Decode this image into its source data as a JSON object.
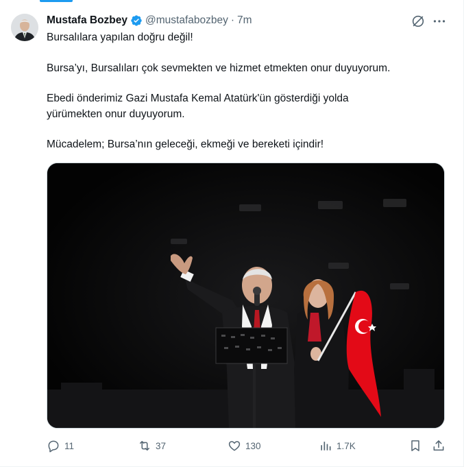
{
  "tweet": {
    "author_name": "Mustafa Bozbey",
    "handle": "@mustafabozbey",
    "separator": "·",
    "time": "7m",
    "lines": [
      "Bursalılara yapılan doğru değil!",
      "Bursa’yı, Bursalıları çok sevmekten ve hizmet etmekten onur duyuyorum.",
      "Ebedi önderimiz Gazi Mustafa Kemal Atatürk'ün gösterdiği yolda",
      "yürümekten onur duyuyorum.",
      "Mücadelem; Bursa’nın geleceği, ekmeği ve bereketi içindir!"
    ]
  },
  "actions": {
    "replies": "11",
    "reposts": "37",
    "likes": "130",
    "views": "1.7K"
  },
  "colors": {
    "accent": "#1d9bf0",
    "text": "#0f1419",
    "secondary": "#536471",
    "flag_red": "#e30a17"
  },
  "icons": [
    "verified-badge-icon",
    "grok-icon",
    "more-icon",
    "reply-icon",
    "repost-icon",
    "like-icon",
    "views-icon",
    "bookmark-icon",
    "share-icon"
  ]
}
